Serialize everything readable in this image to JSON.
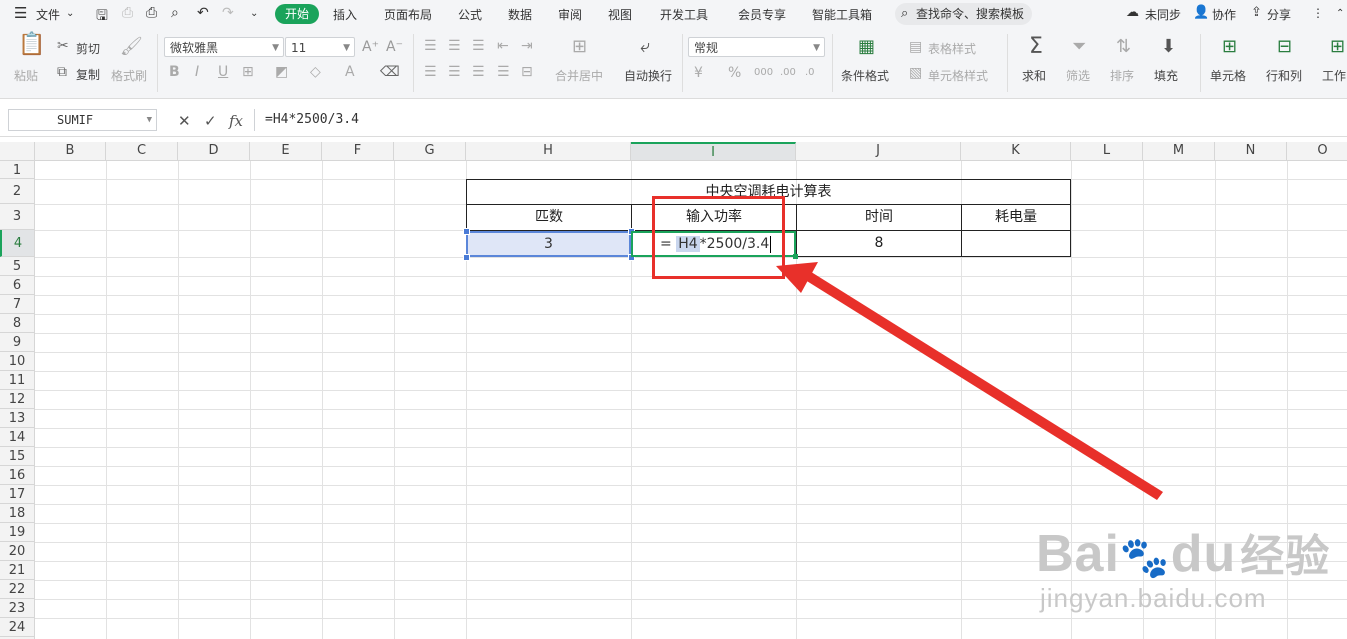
{
  "menubar": {
    "file": "文件",
    "tabs": [
      "开始",
      "插入",
      "页面布局",
      "公式",
      "数据",
      "审阅",
      "视图",
      "开发工具",
      "会员专享",
      "智能工具箱"
    ],
    "search": "查找命令、搜索模板",
    "sync": "未同步",
    "collab": "协作",
    "share": "分享"
  },
  "ribbon": {
    "paste": "粘贴",
    "cut": "剪切",
    "copy": "复制",
    "format_painter": "格式刷",
    "font_name": "微软雅黑",
    "font_size": "11",
    "merge_center": "合并居中",
    "wrap_text": "自动换行",
    "number_format": "常规",
    "conditional_format": "条件格式",
    "table_style": "表格样式",
    "cell_style": "单元格样式",
    "sum": "求和",
    "filter": "筛选",
    "sort": "排序",
    "fill": "填充",
    "cell": "单元格",
    "row_col": "行和列",
    "worksheet": "工作"
  },
  "formula_bar": {
    "name_box": "SUMIF",
    "fx": "fx",
    "formula": "=H4*2500/3.4"
  },
  "grid": {
    "columns": [
      "B",
      "C",
      "D",
      "E",
      "F",
      "G",
      "H",
      "I",
      "J",
      "K",
      "L",
      "M",
      "N",
      "O"
    ],
    "rows": [
      "1",
      "2",
      "3",
      "4",
      "5",
      "6",
      "7",
      "8",
      "9",
      "10",
      "11",
      "12",
      "13",
      "14",
      "15",
      "16",
      "17",
      "18",
      "19",
      "20",
      "21",
      "22",
      "23",
      "24"
    ],
    "active_column": "I",
    "active_row": "4"
  },
  "table": {
    "title": "中央空调耗电计算表",
    "headers": [
      "匹数",
      "输入功率",
      "时间",
      "耗电量"
    ],
    "h4": "3",
    "i4_prefix": "=",
    "i4_ref": "H4",
    "i4_suffix": "*2500/3.4",
    "j4": "8",
    "k4": ""
  },
  "watermark": {
    "brand": "Bai",
    "brand2": "du",
    "cn": "经验",
    "url": "jingyan.baidu.com"
  },
  "colors": {
    "accent": "#1aa35b",
    "annotation": "#e8302a",
    "selection": "#5b86d9"
  }
}
